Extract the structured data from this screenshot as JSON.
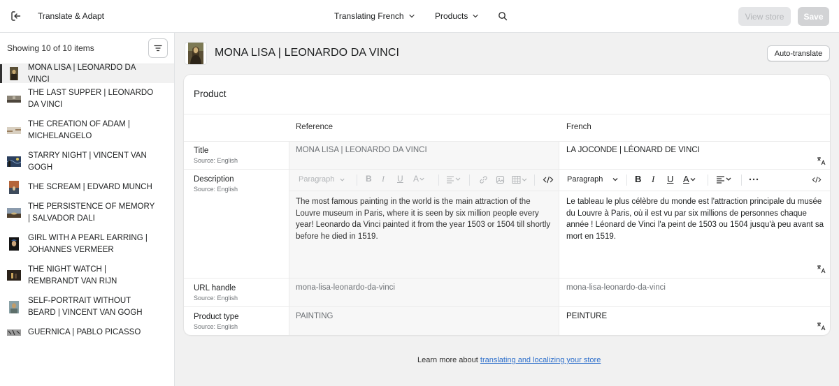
{
  "app": {
    "title": "Translate & Adapt",
    "language_dropdown": "Translating French",
    "resource_dropdown": "Products",
    "view_store_label": "View store",
    "save_label": "Save"
  },
  "sidebar": {
    "count_text": "Showing 10 of 10 items",
    "items": [
      {
        "label": "MONA LISA | LEONARDO DA VINCI",
        "active": true
      },
      {
        "label": "THE LAST SUPPER | LEONARDO DA VINCI"
      },
      {
        "label": "THE CREATION OF ADAM | MICHELANGELO"
      },
      {
        "label": "STARRY NIGHT | VINCENT VAN GOGH"
      },
      {
        "label": "THE SCREAM | EDVARD MUNCH"
      },
      {
        "label": "THE PERSISTENCE OF MEMORY | SALVADOR DALI"
      },
      {
        "label": "GIRL WITH A PEARL EARRING | JOHANNES VERMEER"
      },
      {
        "label": "THE NIGHT WATCH | REMBRANDT VAN RIJN"
      },
      {
        "label": "SELF-PORTRAIT WITHOUT BEARD | VINCENT VAN GOGH"
      },
      {
        "label": "GUERNICA | PABLO PICASSO"
      }
    ]
  },
  "main": {
    "title": "MONA LISA | LEONARDO DA VINCI",
    "auto_translate_label": "Auto-translate",
    "card_title": "Product",
    "col_reference": "Reference",
    "col_french": "French",
    "source_note": "Source: English",
    "fields": {
      "title": {
        "label": "Title",
        "reference": "MONA LISA | LEONARDO DA VINCI",
        "french": "LA JOCONDE | LÉONARD DE VINCI"
      },
      "description": {
        "label": "Description",
        "reference": "The most famous painting in the world is the main attraction of the Louvre museum in Paris, where it is seen by six million people every year! Leonardo da Vinci painted it from the year 1503 or 1504 till shortly before he died in 1519.",
        "french": "Le tableau le plus célèbre du monde est l'attraction principale du musée du Louvre à Paris, où il est vu par six millions de personnes chaque année ! Léonard de Vinci l'a peint de 1503 ou 1504 jusqu'à peu avant sa mort en 1519."
      },
      "url_handle": {
        "label": "URL handle",
        "reference": "mona-lisa-leonardo-da-vinci",
        "french": "mona-lisa-leonardo-da-vinci"
      },
      "product_type": {
        "label": "Product type",
        "reference": "PAINTING",
        "french": "PEINTURE"
      }
    },
    "toolbar": {
      "paragraph": "Paragraph"
    }
  },
  "footer": {
    "text": "Learn more about ",
    "link": "translating and localizing your store"
  },
  "colors": {
    "link": "#2c6ecb",
    "active_marker": "#303030"
  }
}
